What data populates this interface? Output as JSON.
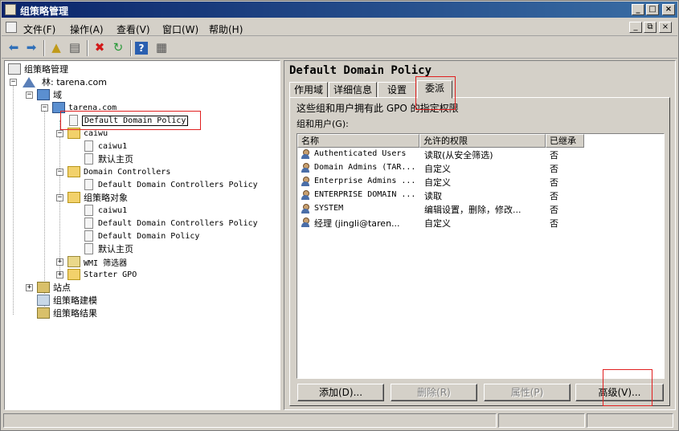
{
  "window": {
    "title": "组策略管理",
    "controls": {
      "minimize": "_",
      "maximize": "□",
      "close": "×"
    }
  },
  "menu": {
    "items": [
      "文件(F)",
      "操作(A)",
      "查看(V)",
      "窗口(W)",
      "帮助(H)"
    ],
    "mdi_controls": {
      "minimize": "_",
      "restore": "⧉",
      "close": "×"
    }
  },
  "toolbar": {
    "icons": [
      "back-arrow-icon",
      "forward-arrow-icon",
      "up-folder-icon",
      "show-hide-tree-icon",
      "delete-icon",
      "refresh-icon",
      "help-icon",
      "properties-icon"
    ]
  },
  "tree": {
    "root": "组策略管理",
    "forest": "林: tarena.com",
    "domains": "域",
    "domain": "tarena.com",
    "selected_link": "Default Domain Policy",
    "ou_caiwu": "caiwu",
    "caiwu_children": [
      "caiwu1",
      "默认主页"
    ],
    "ou_dc": "Domain Controllers",
    "dc_children": [
      "Default Domain Controllers Policy"
    ],
    "gpo_container": "组策略对象",
    "gpo_children": [
      "caiwu1",
      "Default Domain Controllers Policy",
      "Default Domain Policy",
      "默认主页"
    ],
    "wmi": "WMI 筛选器",
    "starter": "Starter GPO",
    "sites": "站点",
    "modeling": "组策略建模",
    "results": "组策略结果"
  },
  "details": {
    "title": "Default Domain Policy",
    "tabs": [
      "作用域",
      "详细信息",
      "设置",
      "委派"
    ],
    "active_tab": "委派",
    "description": "这些组和用户拥有此 GPO 的指定权限",
    "groups_label": "组和用户(G):",
    "columns": [
      "名称",
      "允许的权限",
      "已继承"
    ],
    "rows": [
      {
        "name": "Authenticated Users",
        "permission": "读取(从安全筛选)",
        "inherited": "否"
      },
      {
        "name": "Domain Admins (TAR...",
        "permission": "自定义",
        "inherited": "否"
      },
      {
        "name": "Enterprise Admins ...",
        "permission": "自定义",
        "inherited": "否"
      },
      {
        "name": "ENTERPRISE DOMAIN ...",
        "permission": "读取",
        "inherited": "否"
      },
      {
        "name": "SYSTEM",
        "permission": "编辑设置，删除，修改...",
        "inherited": "否"
      },
      {
        "name": "经理 (jingli@taren...",
        "permission": "自定义",
        "inherited": "否"
      }
    ],
    "buttons": {
      "add": "添加(D)...",
      "remove": "删除(R)",
      "properties": "属性(P)",
      "advanced": "高级(V)..."
    }
  }
}
